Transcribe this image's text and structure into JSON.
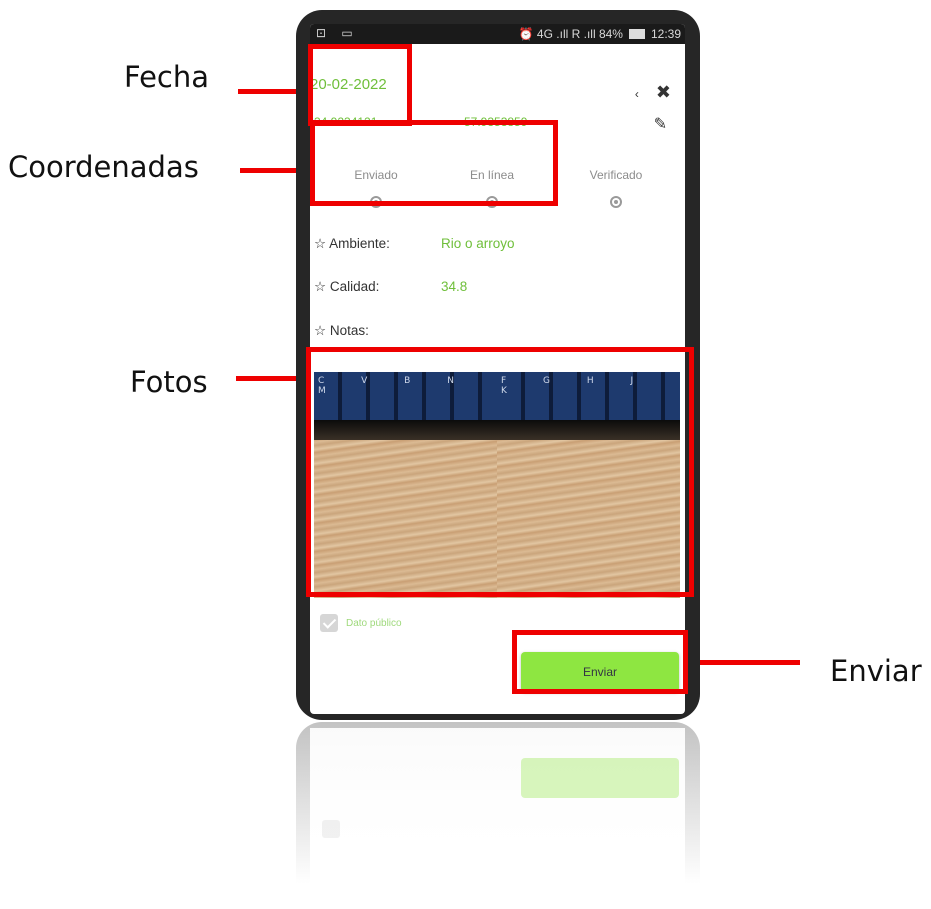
{
  "callouts": {
    "fecha": "Fecha",
    "coordenadas": "Coordenadas",
    "fotos": "Fotos",
    "enviar": "Enviar"
  },
  "statusbar": {
    "left": "⊡ ▭",
    "right": "⏰ 4G .ıll R .ıll 84%",
    "time": "12:39"
  },
  "record": {
    "date": "20-02-2022",
    "latitude": "-34.9234121",
    "longitude": "-57.9353859"
  },
  "status_steps": [
    {
      "label": "Enviado"
    },
    {
      "label": "En línea"
    },
    {
      "label": "Verificado"
    }
  ],
  "fields": {
    "ambiente_label": "☆ Ambiente:",
    "ambiente_value": "Rio o arroyo",
    "calidad_label": "☆ Calidad:",
    "calidad_value": "34.8",
    "notas_label": "☆ Notas:"
  },
  "photos": {
    "left_keys": "C V B N M",
    "right_keys": "F G H J K"
  },
  "public_checkbox": {
    "label": "Dato público",
    "checked": true
  },
  "send_button": {
    "label": "Enviar"
  },
  "colors": {
    "accent": "#6fbf3a",
    "button": "#8ee641",
    "highlight": "#ee0000"
  }
}
